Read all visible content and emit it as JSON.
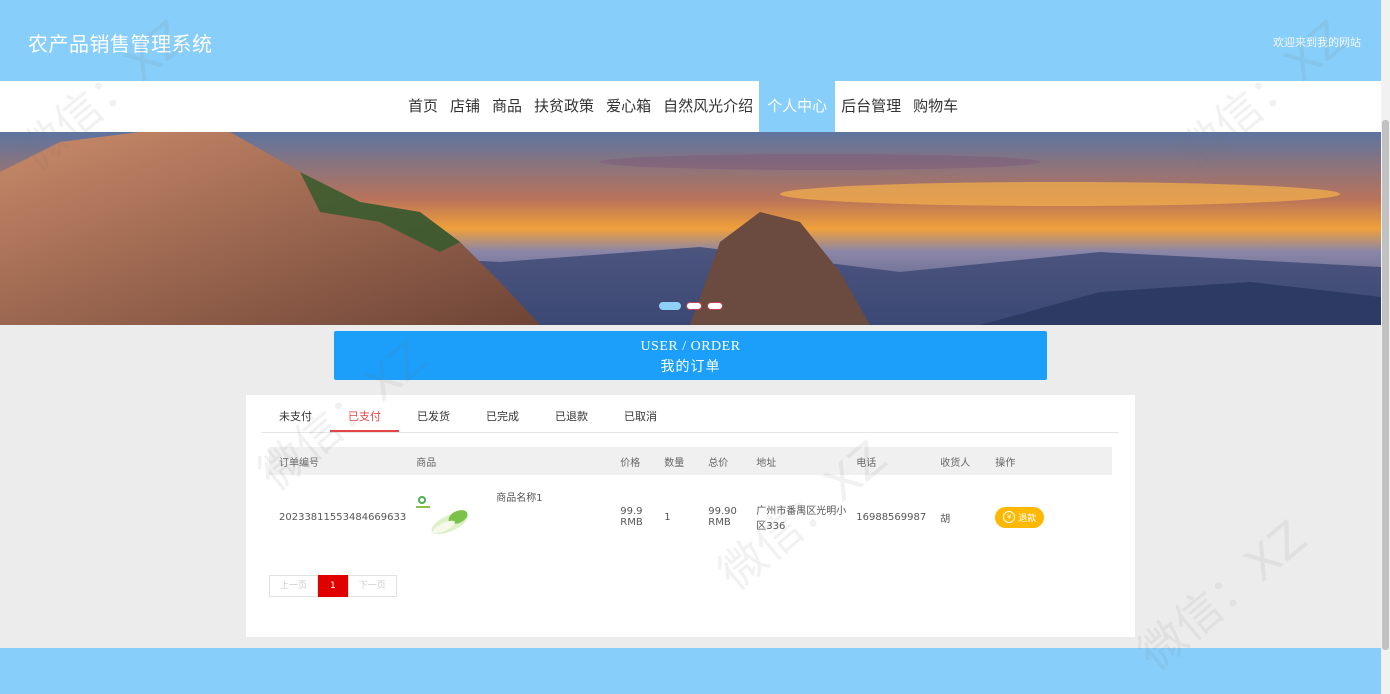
{
  "header": {
    "brand": "农产品销售管理系统",
    "welcome": "欢迎来到我的网站"
  },
  "nav": {
    "items": [
      "首页",
      "店铺",
      "商品",
      "扶贫政策",
      "爱心箱",
      "自然风光介绍",
      "个人中心",
      "后台管理",
      "购物车"
    ],
    "active_index": 6
  },
  "banner": {
    "slide_count": 3,
    "active_slide": 0
  },
  "title": {
    "en": "USER / ORDER",
    "cn": "我的订单"
  },
  "tabs": {
    "items": [
      "未支付",
      "已支付",
      "已发货",
      "已完成",
      "已退款",
      "已取消"
    ],
    "active_index": 1
  },
  "table": {
    "headers": [
      "订单编号",
      "商品",
      "",
      "价格",
      "数量",
      "总价",
      "地址",
      "电话",
      "收货人",
      "操作"
    ],
    "rows": [
      {
        "order_no": "20233811553484669633",
        "product_name": "商品名称1",
        "price": "99.9 RMB",
        "qty": "1",
        "total": "99.90 RMB",
        "address": "广州市番禺区光明小区336",
        "phone": "16988569987",
        "receiver": "胡",
        "action": "退款"
      }
    ]
  },
  "pager": {
    "prev": "上一页",
    "current": "1",
    "next": "下一页"
  },
  "colors": {
    "header_bg": "#87cefa",
    "title_bg": "#1b9ffb",
    "active_tab": "#e54545",
    "refund_btn": "#ffb800",
    "pager_current": "#e00000"
  },
  "watermark": "微信：XZ"
}
